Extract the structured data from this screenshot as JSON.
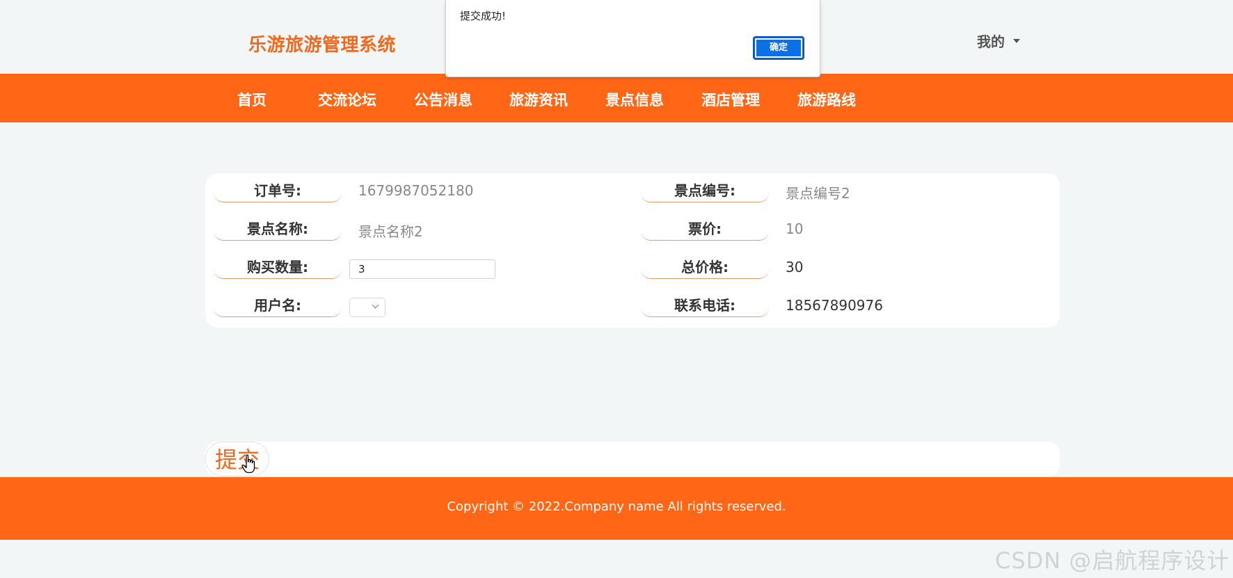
{
  "header": {
    "brand": "乐游旅游管理系统",
    "user_menu": "我的"
  },
  "nav": {
    "items": [
      {
        "label": "首页"
      },
      {
        "label": "交流论坛"
      },
      {
        "label": "公告消息"
      },
      {
        "label": "旅游资讯"
      },
      {
        "label": "景点信息"
      },
      {
        "label": "酒店管理"
      },
      {
        "label": "旅游路线"
      }
    ]
  },
  "form": {
    "order_no": {
      "label": "订单号:",
      "value": "1679987052180"
    },
    "spot_no": {
      "label": "景点编号:",
      "value": "景点编号2"
    },
    "spot_name": {
      "label": "景点名称:",
      "value": "景点名称2"
    },
    "ticket_price": {
      "label": "票价:",
      "value": "10"
    },
    "quantity": {
      "label": "购买数量:",
      "value": "3"
    },
    "total_price": {
      "label": "总价格:",
      "value": "30"
    },
    "username": {
      "label": "用户名:",
      "value": ""
    },
    "phone": {
      "label": "联系电话:",
      "value": "18567890976"
    }
  },
  "submit": {
    "label": "提交"
  },
  "footer": {
    "copyright": "Copyright © 2022.Company name All rights reserved."
  },
  "watermark": "CSDN @启航程序设计",
  "alert": {
    "message": "提交成功!",
    "ok_label": "确定"
  },
  "colors": {
    "accent": "#ff6716",
    "brand_text": "#ef6a1f",
    "alert_button": "#0b6fe8"
  }
}
